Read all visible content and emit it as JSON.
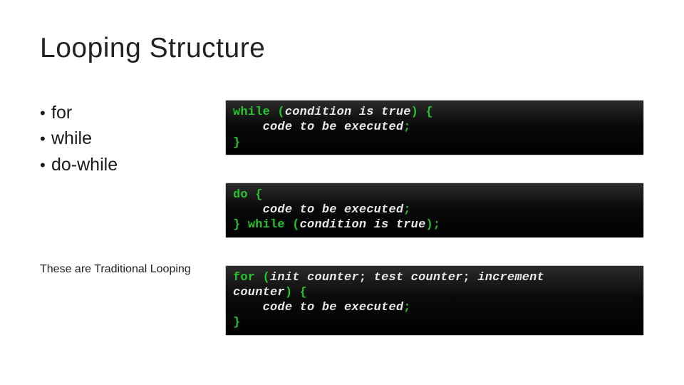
{
  "title": "Looping Structure",
  "bullets": [
    "for",
    "while",
    "do-while"
  ],
  "note": "These are Traditional Looping",
  "code": {
    "while": {
      "l1a": "while",
      "l1b": " (",
      "l1c": "condition is true",
      "l1d": ") {",
      "l2a": "    ",
      "l2b": "code to be executed",
      "l2c": ";",
      "l3a": "}"
    },
    "dowhile": {
      "l1a": "do",
      "l1b": " {",
      "l2a": "    ",
      "l2b": "code to be executed",
      "l2c": ";",
      "l3a": "} ",
      "l3b": "while",
      "l3c": " (",
      "l3d": "condition is true",
      "l3e": ");"
    },
    "for": {
      "l1a": "for",
      "l1b": " (",
      "l1c": "init counter",
      "l1d": "; ",
      "l1e": "test counter",
      "l1f": "; ",
      "l1g": "increment",
      "l2a": "counter",
      "l2b": ") {",
      "l3a": "    ",
      "l3b": "code to be executed",
      "l3c": ";",
      "l4a": "}"
    }
  }
}
